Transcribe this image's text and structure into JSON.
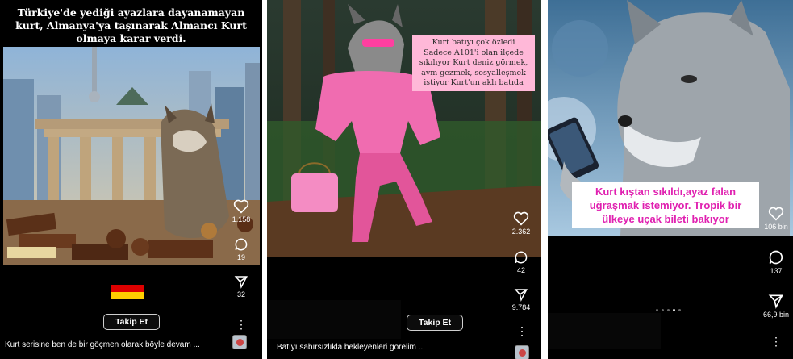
{
  "panel1": {
    "top_caption": [
      "Türkiye'de yediği ayazlara dayanamayan",
      "kurt, Almanya'ya taşınarak Almancı Kurt",
      "olmaya karar verdi."
    ],
    "likes": "1.158",
    "comments": "19",
    "shares": "32",
    "flag": "Germany",
    "follow_label": "Takip Et",
    "bottom_caption": "Kurt serisine ben de bir göçmen olarak böyle devam ..."
  },
  "panel2": {
    "note": [
      "Kurt batıyı çok özledi",
      "Sadece A101'i olan ilçede",
      "sıkılıyor Kurt deniz görmek,",
      "avm gezmek, sosyalleşmek",
      "istiyor Kurt'un aklı batıda"
    ],
    "likes": "2.362",
    "comments": "42",
    "shares": "9.784",
    "follow_label": "Takip Et",
    "bottom_caption": "Batıyı sabırsızlıkla bekleyenleri görelim ..."
  },
  "panel3": {
    "note": [
      "Kurt kıştan sıkıldı,ayaz falan",
      "uğraşmak istemiyor. Tropik bir",
      "ülkeye uçak bileti bakıyor"
    ],
    "likes": "106 bin",
    "comments": "137",
    "shares": "66,9 bin",
    "pager_active": 4,
    "pager_total": 5
  },
  "colors": {
    "follow_border": "#cfcfcf",
    "pink_note_bg": "#ffb8d8",
    "magenta_text": "#e020b0"
  },
  "icons": [
    "heart-icon",
    "comment-icon",
    "send-icon",
    "more-icon",
    "music-icon",
    "germany-flag-icon"
  ]
}
